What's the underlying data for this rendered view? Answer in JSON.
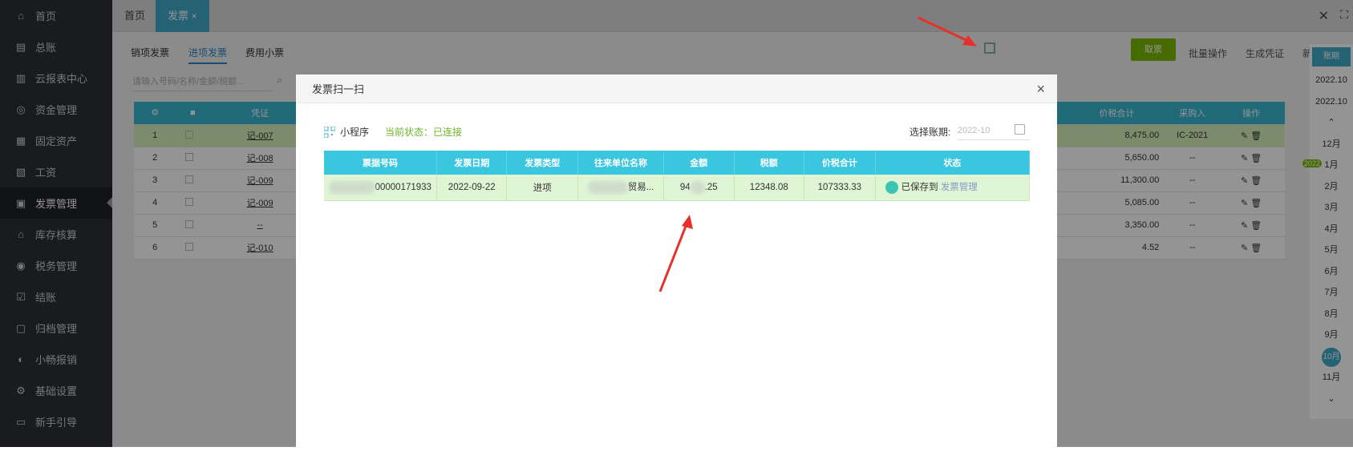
{
  "sidebar": {
    "items": [
      {
        "label": "首页",
        "icon": "home-icon"
      },
      {
        "label": "总账",
        "icon": "ledger-icon"
      },
      {
        "label": "云报表中心",
        "icon": "chart-icon"
      },
      {
        "label": "资金管理",
        "icon": "money-icon"
      },
      {
        "label": "固定资产",
        "icon": "building-icon"
      },
      {
        "label": "工资",
        "icon": "salary-icon"
      },
      {
        "label": "发票管理",
        "icon": "invoice-icon"
      },
      {
        "label": "库存核算",
        "icon": "warehouse-icon"
      },
      {
        "label": "税务管理",
        "icon": "tax-icon"
      },
      {
        "label": "结账",
        "icon": "checkout-icon"
      },
      {
        "label": "归档管理",
        "icon": "archive-icon"
      },
      {
        "label": "小畅报销",
        "icon": "reimburse-icon"
      },
      {
        "label": "基础设置",
        "icon": "gear-icon"
      },
      {
        "label": "新手引导",
        "icon": "guide-icon"
      }
    ],
    "active_index": 6
  },
  "tabs": {
    "home": "首页",
    "invoice": "发票"
  },
  "subtabs": [
    "销项发票",
    "进项发票",
    "费用小票"
  ],
  "search_placeholder": "请输入号码/名称/金额/税额...",
  "toolbar": {
    "cancel": "取票",
    "batch": "批量操作",
    "generate": "生成凭证",
    "add": "新增",
    "refresh": "刷新"
  },
  "bg_table": {
    "headers": {
      "voucher": "凭证",
      "total": "价税合计",
      "buyer": "采购入",
      "ops": "操作"
    },
    "rows": [
      {
        "no": "1",
        "voucher": "记-007",
        "total": "8,475.00",
        "buyer": "IC-2021"
      },
      {
        "no": "2",
        "voucher": "记-008",
        "total": "5,650.00",
        "buyer": "--"
      },
      {
        "no": "3",
        "voucher": "记-009",
        "total": "11,300.00",
        "buyer": "--"
      },
      {
        "no": "4",
        "voucher": "记-009",
        "total": "5,085.00",
        "buyer": "--"
      },
      {
        "no": "5",
        "voucher": "--",
        "total": "3,350.00",
        "buyer": "--"
      },
      {
        "no": "6",
        "voucher": "记-010",
        "total": "4.52",
        "buyer": "--"
      }
    ]
  },
  "right_panel": {
    "period_btn": "账期",
    "periods": [
      "2022.10",
      "2022.10"
    ],
    "year_badge": "2022",
    "months": [
      "12月",
      "1月",
      "2月",
      "3月",
      "4月",
      "5月",
      "6月",
      "7月",
      "8月",
      "9月",
      "10月",
      "11月"
    ],
    "active_month": "10月"
  },
  "modal": {
    "title": "发票扫一扫",
    "mini_program": "小程序",
    "status_label": "当前状态：",
    "status_value": "已连接",
    "period_label": "选择账期:",
    "period_placeholder": "2022-10",
    "columns": [
      "票据号码",
      "发票日期",
      "发票类型",
      "往来单位名称",
      "金额",
      "税额",
      "价税合计",
      "状态"
    ],
    "row": {
      "number": "00000171933",
      "date": "2022-09-22",
      "type": "进项",
      "company": "贸易...",
      "amount_prefix": "94",
      "amount_suffix": ".25",
      "tax": "12348.08",
      "total": "107333.33",
      "status_text": "已保存到",
      "status_link": "发票管理"
    }
  },
  "colors": {
    "accent": "#3fa9c8",
    "header": "#3ac6df",
    "row": "#dff5d4",
    "green": "#6cb62b",
    "arrow": "#e8302a"
  }
}
